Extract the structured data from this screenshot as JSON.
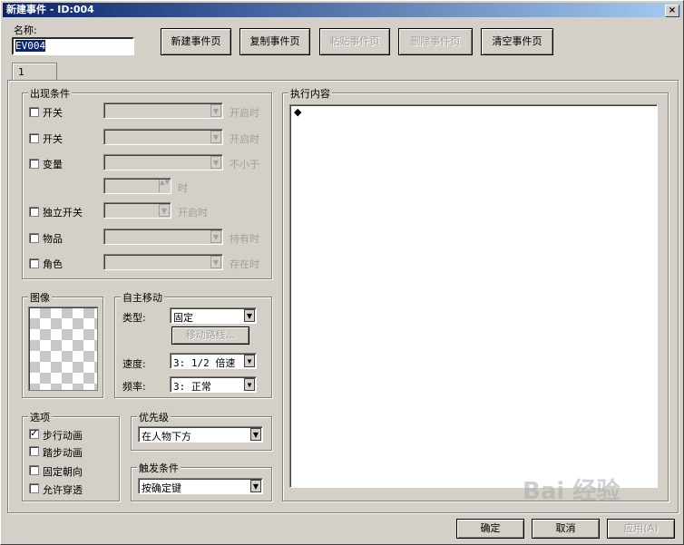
{
  "window": {
    "title": "新建事件 - ID:004",
    "close_glyph": "×"
  },
  "name_field": {
    "label": "名称:",
    "value": "EV004"
  },
  "toolbar": {
    "new_page": "新建事件页",
    "copy_page": "复制事件页",
    "paste_page": "粘贴事件页",
    "delete_page": "删除事件页",
    "clear_page": "清空事件页"
  },
  "tabs": [
    "1"
  ],
  "conditions": {
    "title": "出现条件",
    "switch1": {
      "label": "开关",
      "suffix": "开启时"
    },
    "switch2": {
      "label": "开关",
      "suffix": "开启时"
    },
    "variable": {
      "label": "变量",
      "suffix": "不小于",
      "suffix2": "时"
    },
    "self_switch": {
      "label": "独立开关",
      "suffix": "开启时"
    },
    "item": {
      "label": "物品",
      "suffix": "持有时"
    },
    "actor": {
      "label": "角色",
      "suffix": "存在时"
    }
  },
  "image": {
    "title": "图像"
  },
  "autonomous": {
    "title": "自主移动",
    "type_label": "类型:",
    "type_value": "固定",
    "route_button": "移动路线...",
    "speed_label": "速度:",
    "speed_value": "3: 1/2 倍速",
    "freq_label": "频率:",
    "freq_value": "3: 正常"
  },
  "options": {
    "title": "选项",
    "walking_anim": {
      "label": "步行动画",
      "checked": true
    },
    "stepping_anim": {
      "label": "踏步动画",
      "checked": false
    },
    "direction_fix": {
      "label": "固定朝向",
      "checked": false
    },
    "through": {
      "label": "允许穿透",
      "checked": false
    }
  },
  "priority": {
    "title": "优先级",
    "value": "在人物下方"
  },
  "trigger": {
    "title": "触发条件",
    "value": "按确定键"
  },
  "contents": {
    "title": "执行内容",
    "first_line": "◆"
  },
  "footer": {
    "ok": "确定",
    "cancel": "取消",
    "apply": "应用(A)"
  },
  "watermark": "Bai 经验",
  "check_glyph": "✓",
  "dropdown_glyph": "▼",
  "spin_glyph": "▲▼"
}
